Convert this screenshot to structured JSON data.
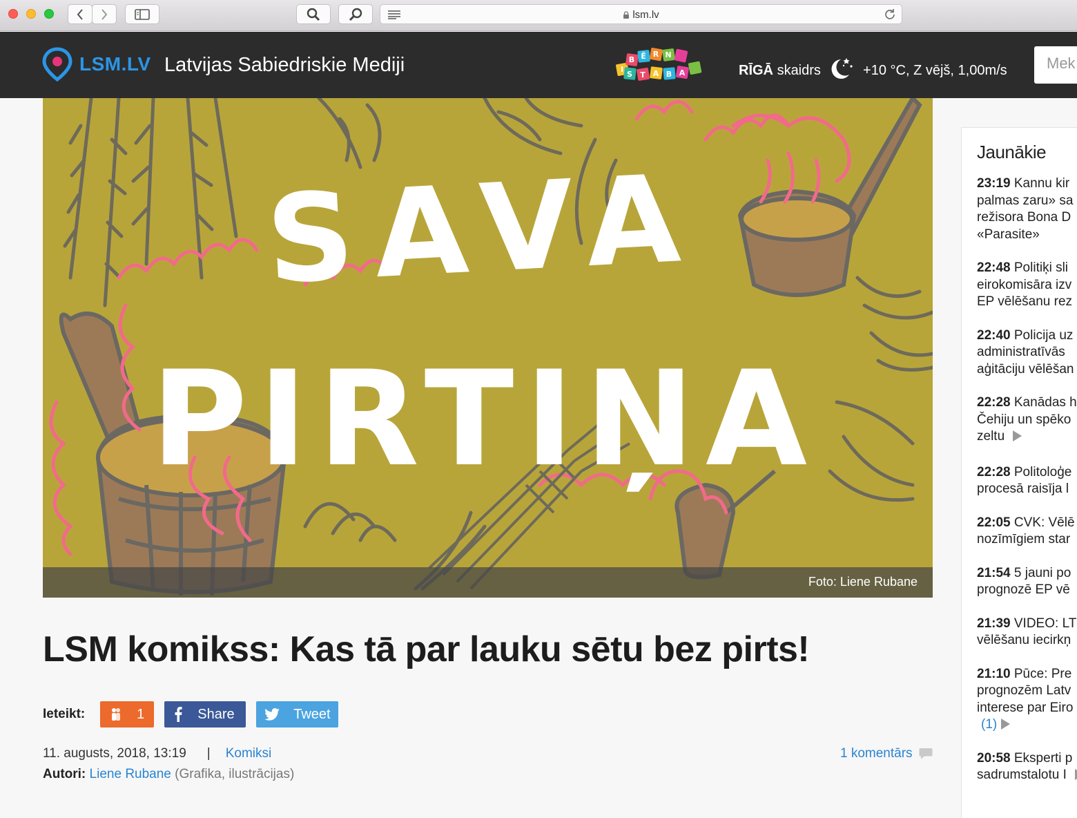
{
  "browser": {
    "url": "lsm.lv"
  },
  "header": {
    "logo_text": "LSM.LV",
    "site_name": "Latvijas Sabiedriskie Mediji",
    "kids_logo_text": "BĒRNISTABA",
    "weather": {
      "city": "RĪGĀ",
      "condition": "skaidrs",
      "details": "+10 °C, Z vējš, 1,00m/s"
    },
    "search_placeholder": "Mek"
  },
  "article": {
    "hero_title_line1": "SAVA",
    "hero_title_line2": "PIRTIŅA",
    "photo_credit": "Foto: Liene Rubane",
    "headline": "LSM komikss: Kas tā par lauku sētu bez pirts!",
    "share": {
      "label": "Ieteikt:",
      "recommend_count": "1",
      "facebook_label": "Share",
      "twitter_label": "Tweet"
    },
    "date": "11. augusts, 2018, 13:19",
    "separator": "|",
    "category": "Komiksi",
    "comments": "1 komentārs",
    "authors_label": "Autori:",
    "author": "Liene Rubane",
    "author_role": "(Grafika, ilustrācijas)"
  },
  "sidebar": {
    "title": "Jaunākie",
    "items": [
      {
        "time": "23:19",
        "lines": [
          " Kannu kir",
          "palmas zaru» sa",
          "režisora Bona D",
          "«Parasite»"
        ]
      },
      {
        "time": "22:48",
        "lines": [
          " Politiķi sli",
          "eirokomisāra izv",
          "EP vēlēšanu rez"
        ]
      },
      {
        "time": "22:40",
        "lines": [
          " Policija uz",
          "administratīvās",
          "aģitāciju vēlēšan"
        ]
      },
      {
        "time": "22:28",
        "lines": [
          " Kanādas h",
          "Čehiju un spēko",
          "zeltu"
        ],
        "video": true
      },
      {
        "time": "22:28",
        "lines": [
          " Politoloģe",
          "procesā raisīja l"
        ]
      },
      {
        "time": "22:05",
        "lines": [
          " CVK: Vēlē",
          "nozīmīgiem star"
        ]
      },
      {
        "time": "21:54",
        "lines": [
          " 5 jauni po",
          "prognozē EP vē"
        ]
      },
      {
        "time": "21:39",
        "lines": [
          " VIDEO: LT",
          "vēlēšanu iecirkņ"
        ]
      },
      {
        "time": "21:10",
        "lines": [
          " Pūce: Pre",
          "prognozēm Latv",
          "interese par Eiro"
        ],
        "comment_count": "(1)",
        "video": true
      },
      {
        "time": "20:58",
        "lines": [
          " Eksperti p",
          "sadrumstalotu I"
        ],
        "video": true
      }
    ]
  },
  "colors": {
    "header_bg": "#2c2c2c",
    "logo_blue": "#2c95e6",
    "link_blue": "#2a84d2",
    "recommend_orange": "#ec6a2c",
    "facebook_blue": "#3b5998",
    "twitter_blue": "#4ba3e0",
    "hero_bg": "#b8a53a"
  }
}
